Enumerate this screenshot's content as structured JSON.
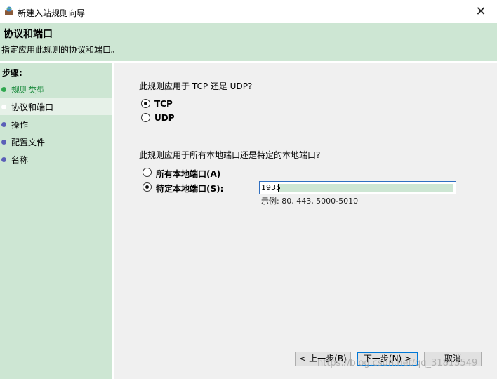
{
  "window": {
    "title": "新建入站规则向导",
    "icon": "firewall-icon",
    "close_glyph": "✕"
  },
  "header": {
    "title": "协议和端口",
    "subtitle": "指定应用此规则的协议和端口。"
  },
  "steps": {
    "title": "步骤:",
    "items": [
      {
        "label": "规则类型",
        "state": "done"
      },
      {
        "label": "协议和端口",
        "state": "current"
      },
      {
        "label": "操作",
        "state": "todo"
      },
      {
        "label": "配置文件",
        "state": "todo"
      },
      {
        "label": "名称",
        "state": "todo"
      }
    ]
  },
  "protocol": {
    "question": "此规则应用于 TCP 还是 UDP?",
    "options": [
      {
        "label": "TCP",
        "selected": true
      },
      {
        "label": "UDP",
        "selected": false
      }
    ]
  },
  "ports": {
    "question": "此规则应用于所有本地端口还是特定的本地端口?",
    "options": [
      {
        "label": "所有本地端口(A)",
        "selected": false
      },
      {
        "label": "特定本地端口(S):",
        "selected": true
      }
    ],
    "value": "1935",
    "example": "示例: 80, 443, 5000-5010"
  },
  "buttons": {
    "back": "< 上一步(B)",
    "next": "下一步(N) >",
    "cancel": "取消"
  },
  "watermark": "https://blog.csdn.net/qq_31813549",
  "colors": {
    "header_bg": "#cde6d3",
    "done_step": "#1a8a3c",
    "todo_dot": "#5b5fb8",
    "focus_border": "#0078d7"
  }
}
